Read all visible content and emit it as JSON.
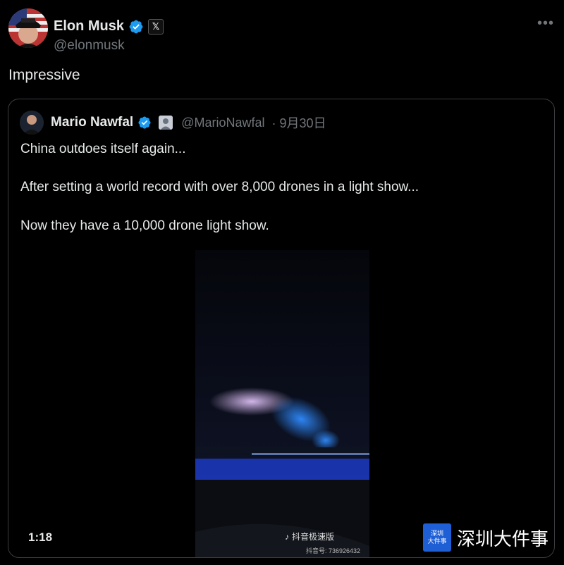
{
  "tweet": {
    "author_name": "Elon Musk",
    "author_handle": "@elonmusk",
    "text": "Impressive",
    "x_badge": "𝕏"
  },
  "quote": {
    "author_name": "Mario Nawfal",
    "author_handle": "@MarioNawfal",
    "date": "· 9月30日",
    "lines": [
      "China outdoes itself again...",
      "After setting a world record with over 8,000 drones in a light show...",
      "Now they have a 10,000 drone light show."
    ],
    "video": {
      "duration": "1:18",
      "tiktok_label": "抖音极速版",
      "tiktok_id": "抖音号: 736926432",
      "watermark_logo": "深圳\n大件事",
      "watermark_text": "深圳大件事"
    }
  },
  "colors": {
    "verified": "#1d9bf0",
    "background": "#000000",
    "text": "#e7e9ea",
    "muted": "#71767b"
  }
}
